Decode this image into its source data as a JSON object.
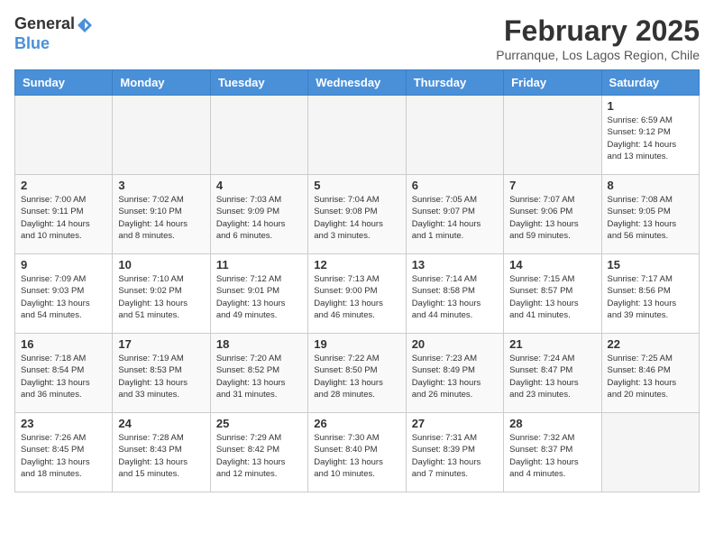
{
  "header": {
    "logo_general": "General",
    "logo_blue": "Blue",
    "month_year": "February 2025",
    "location": "Purranque, Los Lagos Region, Chile"
  },
  "weekdays": [
    "Sunday",
    "Monday",
    "Tuesday",
    "Wednesday",
    "Thursday",
    "Friday",
    "Saturday"
  ],
  "weeks": [
    [
      {
        "day": "",
        "info": ""
      },
      {
        "day": "",
        "info": ""
      },
      {
        "day": "",
        "info": ""
      },
      {
        "day": "",
        "info": ""
      },
      {
        "day": "",
        "info": ""
      },
      {
        "day": "",
        "info": ""
      },
      {
        "day": "1",
        "info": "Sunrise: 6:59 AM\nSunset: 9:12 PM\nDaylight: 14 hours\nand 13 minutes."
      }
    ],
    [
      {
        "day": "2",
        "info": "Sunrise: 7:00 AM\nSunset: 9:11 PM\nDaylight: 14 hours\nand 10 minutes."
      },
      {
        "day": "3",
        "info": "Sunrise: 7:02 AM\nSunset: 9:10 PM\nDaylight: 14 hours\nand 8 minutes."
      },
      {
        "day": "4",
        "info": "Sunrise: 7:03 AM\nSunset: 9:09 PM\nDaylight: 14 hours\nand 6 minutes."
      },
      {
        "day": "5",
        "info": "Sunrise: 7:04 AM\nSunset: 9:08 PM\nDaylight: 14 hours\nand 3 minutes."
      },
      {
        "day": "6",
        "info": "Sunrise: 7:05 AM\nSunset: 9:07 PM\nDaylight: 14 hours\nand 1 minute."
      },
      {
        "day": "7",
        "info": "Sunrise: 7:07 AM\nSunset: 9:06 PM\nDaylight: 13 hours\nand 59 minutes."
      },
      {
        "day": "8",
        "info": "Sunrise: 7:08 AM\nSunset: 9:05 PM\nDaylight: 13 hours\nand 56 minutes."
      }
    ],
    [
      {
        "day": "9",
        "info": "Sunrise: 7:09 AM\nSunset: 9:03 PM\nDaylight: 13 hours\nand 54 minutes."
      },
      {
        "day": "10",
        "info": "Sunrise: 7:10 AM\nSunset: 9:02 PM\nDaylight: 13 hours\nand 51 minutes."
      },
      {
        "day": "11",
        "info": "Sunrise: 7:12 AM\nSunset: 9:01 PM\nDaylight: 13 hours\nand 49 minutes."
      },
      {
        "day": "12",
        "info": "Sunrise: 7:13 AM\nSunset: 9:00 PM\nDaylight: 13 hours\nand 46 minutes."
      },
      {
        "day": "13",
        "info": "Sunrise: 7:14 AM\nSunset: 8:58 PM\nDaylight: 13 hours\nand 44 minutes."
      },
      {
        "day": "14",
        "info": "Sunrise: 7:15 AM\nSunset: 8:57 PM\nDaylight: 13 hours\nand 41 minutes."
      },
      {
        "day": "15",
        "info": "Sunrise: 7:17 AM\nSunset: 8:56 PM\nDaylight: 13 hours\nand 39 minutes."
      }
    ],
    [
      {
        "day": "16",
        "info": "Sunrise: 7:18 AM\nSunset: 8:54 PM\nDaylight: 13 hours\nand 36 minutes."
      },
      {
        "day": "17",
        "info": "Sunrise: 7:19 AM\nSunset: 8:53 PM\nDaylight: 13 hours\nand 33 minutes."
      },
      {
        "day": "18",
        "info": "Sunrise: 7:20 AM\nSunset: 8:52 PM\nDaylight: 13 hours\nand 31 minutes."
      },
      {
        "day": "19",
        "info": "Sunrise: 7:22 AM\nSunset: 8:50 PM\nDaylight: 13 hours\nand 28 minutes."
      },
      {
        "day": "20",
        "info": "Sunrise: 7:23 AM\nSunset: 8:49 PM\nDaylight: 13 hours\nand 26 minutes."
      },
      {
        "day": "21",
        "info": "Sunrise: 7:24 AM\nSunset: 8:47 PM\nDaylight: 13 hours\nand 23 minutes."
      },
      {
        "day": "22",
        "info": "Sunrise: 7:25 AM\nSunset: 8:46 PM\nDaylight: 13 hours\nand 20 minutes."
      }
    ],
    [
      {
        "day": "23",
        "info": "Sunrise: 7:26 AM\nSunset: 8:45 PM\nDaylight: 13 hours\nand 18 minutes."
      },
      {
        "day": "24",
        "info": "Sunrise: 7:28 AM\nSunset: 8:43 PM\nDaylight: 13 hours\nand 15 minutes."
      },
      {
        "day": "25",
        "info": "Sunrise: 7:29 AM\nSunset: 8:42 PM\nDaylight: 13 hours\nand 12 minutes."
      },
      {
        "day": "26",
        "info": "Sunrise: 7:30 AM\nSunset: 8:40 PM\nDaylight: 13 hours\nand 10 minutes."
      },
      {
        "day": "27",
        "info": "Sunrise: 7:31 AM\nSunset: 8:39 PM\nDaylight: 13 hours\nand 7 minutes."
      },
      {
        "day": "28",
        "info": "Sunrise: 7:32 AM\nSunset: 8:37 PM\nDaylight: 13 hours\nand 4 minutes."
      },
      {
        "day": "",
        "info": ""
      }
    ]
  ]
}
